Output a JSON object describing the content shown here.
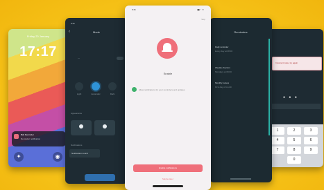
{
  "lockscreen": {
    "date": "Friday 20 January",
    "time": "17:17",
    "notification": {
      "title": "Ball Reminder",
      "body": "Reminder notification"
    }
  },
  "settings": {
    "status_time": "9:41",
    "title": "Mode",
    "modes": [
      "Light",
      "Automatic",
      "Dark"
    ],
    "section1": "Appearance",
    "section2": "Notifications",
    "field_label": "Notification sound",
    "button": "Save"
  },
  "center": {
    "status_time": "9:41",
    "status_icons": "▮▮ ◔ ▭",
    "skip": "Skip",
    "title": "Enable",
    "checkbox_text": "Allow notifications for your reminders and updates",
    "primary_button": "Enable notifications",
    "secondary_button": "Maybe later"
  },
  "list": {
    "title": "Reminders",
    "items": [
      {
        "label": "Daily reminder",
        "sub": "Every day at 08:00"
      },
      {
        "label": "Weekly check-in",
        "sub": "Mondays at 09:00"
      },
      {
        "label": "Monthly review",
        "sub": "First day of month"
      }
    ]
  },
  "pin": {
    "alert": "Incorrect code, try again",
    "keys": [
      "1",
      "2",
      "3",
      "4",
      "5",
      "6",
      "7",
      "8",
      "9",
      "",
      "0",
      "⌫"
    ]
  }
}
